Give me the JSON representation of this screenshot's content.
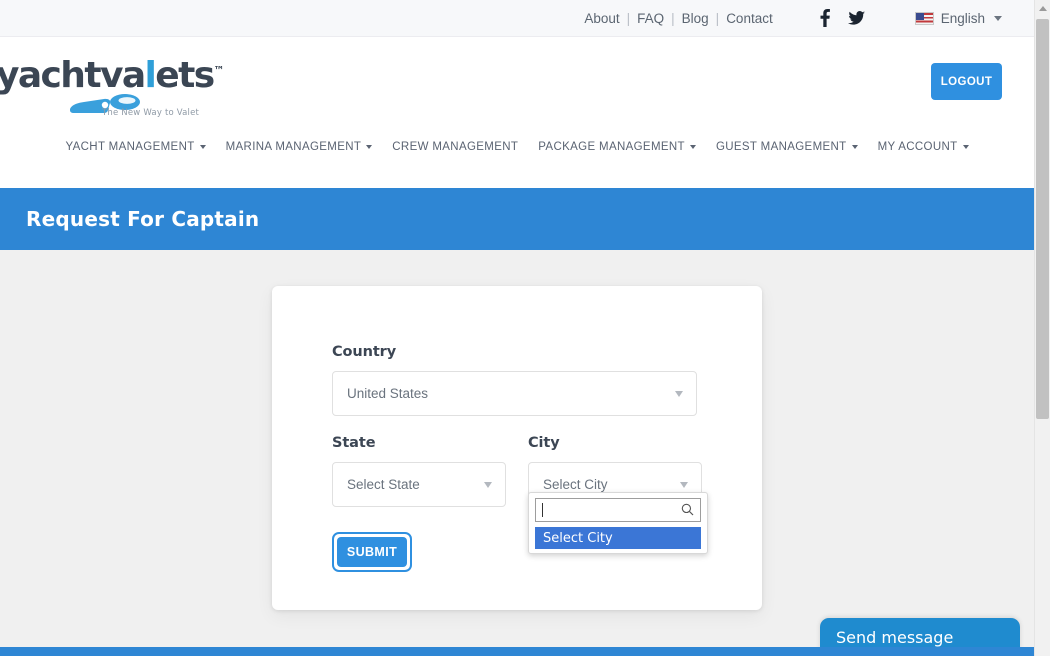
{
  "topbar": {
    "links": [
      {
        "label": "About"
      },
      {
        "label": "FAQ"
      },
      {
        "label": "Blog"
      },
      {
        "label": "Contact"
      }
    ],
    "separator": "|",
    "social": [
      {
        "name": "facebook-icon",
        "label": "Facebook"
      },
      {
        "name": "twitter-icon",
        "label": "Twitter"
      }
    ],
    "language": {
      "label": "English",
      "flag": "us-flag-icon"
    }
  },
  "header": {
    "logo": {
      "text_part1": "yacht",
      "text_part2": "va",
      "text_part3": "l",
      "text_part4": "ets",
      "trademark": "™",
      "tagline": "The New Way to Valet"
    },
    "logout_label": "LOGOUT"
  },
  "nav": {
    "items": [
      {
        "label": "YACHT MANAGEMENT",
        "has_caret": true
      },
      {
        "label": "MARINA MANAGEMENT",
        "has_caret": true
      },
      {
        "label": "CREW MANAGEMENT",
        "has_caret": false
      },
      {
        "label": "PACKAGE MANAGEMENT",
        "has_caret": true
      },
      {
        "label": "GUEST MANAGEMENT",
        "has_caret": true
      },
      {
        "label": "MY ACCOUNT",
        "has_caret": true
      }
    ]
  },
  "banner": {
    "title": "Request For Captain"
  },
  "form": {
    "country": {
      "label": "Country",
      "value": "United States"
    },
    "state": {
      "label": "State",
      "value": "Select State"
    },
    "city": {
      "label": "City",
      "value": "Select City",
      "dropdown_open": true,
      "search_value": "",
      "search_placeholder": "",
      "options": [
        {
          "label": "Select City",
          "selected": true
        }
      ]
    },
    "submit_label": "SUBMIT"
  },
  "chat": {
    "label": "Send message"
  },
  "colors": {
    "brand_blue": "#2e86d4",
    "button_blue": "#2f90e0",
    "option_highlight": "#3b76d6",
    "chat_blue": "#1f8bcf",
    "topbar_bg": "#f7f8fa",
    "page_bg": "#f0f0f0",
    "text_dark": "#3c4654",
    "text_muted": "#6a737e"
  }
}
